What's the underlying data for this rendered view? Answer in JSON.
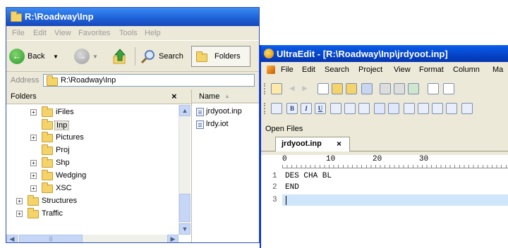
{
  "explorer": {
    "title": "R:\\Roadway\\Inp",
    "menu": [
      "File",
      "Edit",
      "View",
      "Favorites",
      "Tools",
      "Help"
    ],
    "toolbar": {
      "back_label": "Back",
      "search_label": "Search",
      "folders_label": "Folders"
    },
    "address": {
      "label": "Address",
      "value": "R:\\Roadway\\Inp"
    },
    "folders_pane": {
      "title": "Folders",
      "close_glyph": "×"
    },
    "tree": [
      {
        "name": "iFiles",
        "expander": "+"
      },
      {
        "name": "Inp",
        "expander": ""
      },
      {
        "name": "Pictures",
        "expander": "+"
      },
      {
        "name": "Proj",
        "expander": ""
      },
      {
        "name": "Shp",
        "expander": "+"
      },
      {
        "name": "Wedging",
        "expander": "+"
      },
      {
        "name": "XSC",
        "expander": "+"
      },
      {
        "name": "Structures",
        "expander": "+"
      },
      {
        "name": "Traffic",
        "expander": "+"
      }
    ],
    "files_pane": {
      "column": "Name",
      "sort_glyph": "▲"
    },
    "files": [
      "jrdyoot.inp",
      "lrdy.iot"
    ]
  },
  "ultraedit": {
    "title": "UltraEdit - [R:\\Roadway\\Inp\\jrdyoot.inp]",
    "menu": [
      "File",
      "Edit",
      "Search",
      "Project",
      "View",
      "Format",
      "Column",
      "Ma"
    ],
    "toolbar2_glyphs": [
      "B",
      "I",
      "U"
    ],
    "open_files_label": "Open Files",
    "tab": {
      "name": "jrdyoot.inp",
      "close_glyph": "×"
    },
    "ruler": {
      "zero": "0",
      "labels": [
        "10",
        "20",
        "30"
      ]
    },
    "lines": [
      {
        "no": "1",
        "text": "DES CHA BL"
      },
      {
        "no": "2",
        "text": "END"
      },
      {
        "no": "3",
        "text": ""
      }
    ]
  },
  "colors": {
    "xp_title_blue": "#1d5fd6",
    "current_line_highlight": "#cfe6fb",
    "window_face": "#ece9d8"
  }
}
